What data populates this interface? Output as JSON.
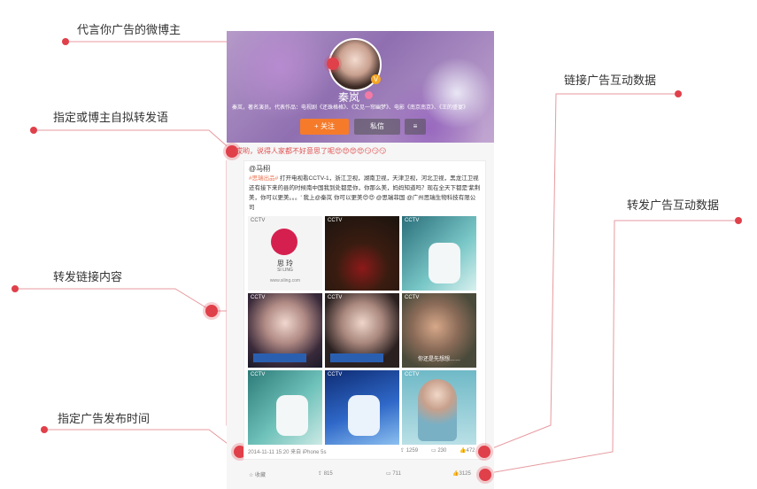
{
  "annotations": {
    "blogger": "代言你广告的微博主",
    "repost_text": "指定或博主自拟转发语",
    "repost_content": "转发链接内容",
    "publish_time": "指定广告发布时间",
    "link_interaction": "链接广告互动数据",
    "repost_interaction": "转发广告互动数据"
  },
  "profile": {
    "name": "秦岚",
    "bio": "秦岚，著名演员。代表作品：电视剧《还珠格格》、《又见一帘幽梦》、电影《南京南京》、《王的盛宴》",
    "follow_label": "+ 关注",
    "message_label": "私信",
    "more_label": "≡",
    "verified": "V"
  },
  "post": {
    "repost_text": "哎哟，说得人家都不好意思了呢😍😍😍😍😏😏😏",
    "original_author": "@马栩",
    "original_text_kw": "#思瑞出品#",
    "original_text": " 打开电视看CCTV-1，浙江卫视，湖南卫视，天津卫视，河北卫视，黑龙江卫视还有接下来的县的时候南中国我到处都是你，你那么美，妈妈知道吗？现在全天下都是'紫荆美，你可以更美。。。' 我上@秦岚 你可以更美😍😍 @思瑞菲国 @广州思瑞生物科技有限公司",
    "images": [
      {
        "tag": "CCTV"
      },
      {
        "tag": "CCTV"
      },
      {
        "tag": "CCTV"
      },
      {
        "tag": "CCTV"
      },
      {
        "tag": "CCTV"
      },
      {
        "tag": "CCTV"
      },
      {
        "tag": "CCTV"
      },
      {
        "tag": "CCTV"
      },
      {
        "tag": "CCTV"
      }
    ],
    "brand_logo_text": "思 玲",
    "brand_logo_sub": "SI LING",
    "brand_url": "www.siling.com",
    "caption_8": "你还是先想想……",
    "orig_meta": "2014-11-11 15:20 来自 iPhone 5s",
    "orig_repost": "1259",
    "orig_comment": "230",
    "orig_like": "472",
    "collect_label": "收藏",
    "repost_count": "815",
    "comment_count": "711",
    "like_count": "3125"
  },
  "colors": {
    "accent": "#e0404a",
    "follow": "#f57b2b",
    "link": "#eb7350"
  }
}
